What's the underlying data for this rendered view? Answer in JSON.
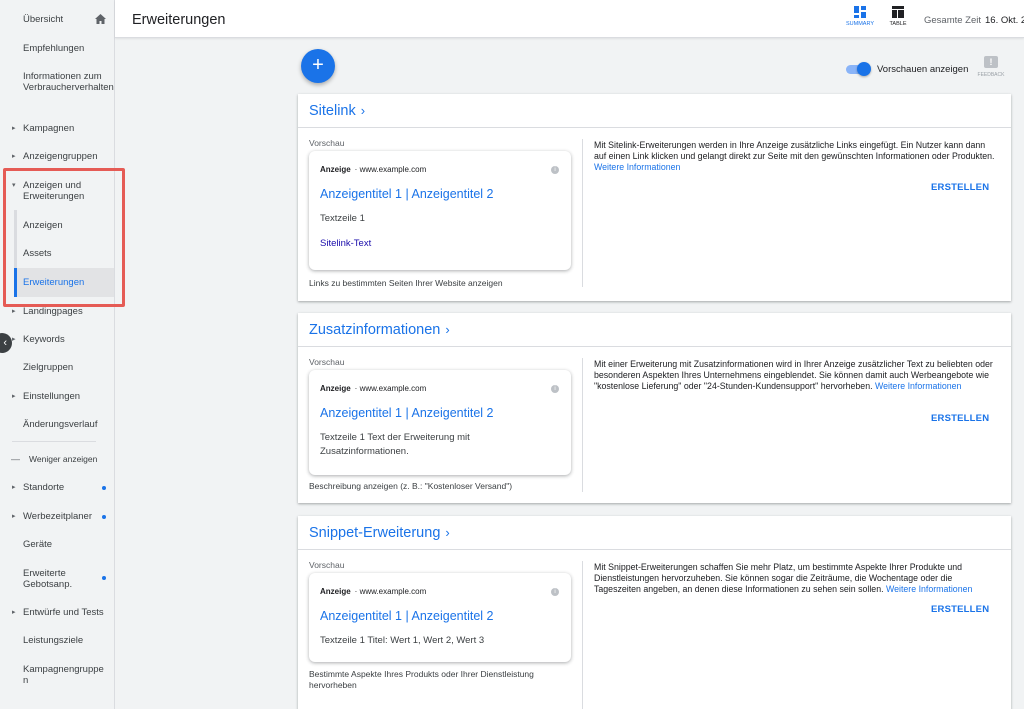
{
  "header": {
    "title": "Erweiterungen",
    "view_summary": "SUMMARY",
    "view_table": "TABLE",
    "range_label": "Gesamte Zeit",
    "range_date": "16. Okt. 2"
  },
  "sidebar": {
    "items": [
      {
        "id": "uebersicht",
        "label": "Übersicht"
      },
      {
        "id": "empfehlungen",
        "label": "Empfehlungen"
      },
      {
        "id": "verbraucher",
        "label": "Informationen zum Verbraucherverhalten"
      },
      {
        "id": "kampagnen",
        "label": "Kampagnen"
      },
      {
        "id": "anzeigengruppen",
        "label": "Anzeigengruppen"
      },
      {
        "id": "anzeigen-erweiterungen",
        "label": "Anzeigen und Erweiterungen"
      },
      {
        "id": "anzeigen",
        "label": "Anzeigen"
      },
      {
        "id": "assets",
        "label": "Assets"
      },
      {
        "id": "erweiterungen",
        "label": "Erweiterungen"
      },
      {
        "id": "landingpages",
        "label": "Landingpages"
      },
      {
        "id": "keywords",
        "label": "Keywords"
      },
      {
        "id": "zielgruppen",
        "label": "Zielgruppen"
      },
      {
        "id": "einstellungen",
        "label": "Einstellungen"
      },
      {
        "id": "aenderungsverlauf",
        "label": "Änderungsverlauf"
      },
      {
        "id": "weniger",
        "label": "Weniger anzeigen"
      },
      {
        "id": "standorte",
        "label": "Standorte"
      },
      {
        "id": "werbezeitplaner",
        "label": "Werbezeitplaner"
      },
      {
        "id": "geraete",
        "label": "Geräte"
      },
      {
        "id": "gebotsanp",
        "label": "Erweiterte Gebotsanp."
      },
      {
        "id": "entwuerfe",
        "label": "Entwürfe und Tests"
      },
      {
        "id": "leistungsziele",
        "label": "Leistungsziele"
      },
      {
        "id": "kampagnengruppen",
        "label": "Kampagnengruppen"
      }
    ],
    "collapse_glyph": "‹"
  },
  "toolbar": {
    "add_glyph": "+",
    "preview_toggle_label": "Vorschauen anzeigen",
    "feedback_label": "FEEDBACK"
  },
  "cards": [
    {
      "title": "Sitelink",
      "preview_label": "Vorschau",
      "ad_label": "Anzeige",
      "ad_url": "www.example.com",
      "ad_headline": "Anzeigentitel 1 | Anzeigentitel 2",
      "ad_text": "Textzeile 1",
      "ad_link": "Sitelink-Text",
      "caption": "Links zu bestimmten Seiten Ihrer Website anzeigen",
      "description": "Mit Sitelink-Erweiterungen werden in Ihre Anzeige zusätzliche Links eingefügt. Ein Nutzer kann dann auf einen Link klicken und gelangt direkt zur Seite mit den gewünschten Informationen oder Produkten.",
      "more_link": "Weitere Informationen",
      "create_label": "ERSTELLEN"
    },
    {
      "title": "Zusatzinformationen",
      "preview_label": "Vorschau",
      "ad_label": "Anzeige",
      "ad_url": "www.example.com",
      "ad_headline": "Anzeigentitel 1 | Anzeigentitel 2",
      "ad_text": "Textzeile 1 Text der Erweiterung mit Zusatzinformationen.",
      "caption": "Beschreibung anzeigen (z. B.: \"Kostenloser Versand\")",
      "description": "Mit einer Erweiterung mit Zusatzinformationen wird in Ihrer Anzeige zusätzlicher Text zu beliebten oder besonderen Aspekten Ihres Unternehmens eingeblendet. Sie können damit auch Werbeangebote wie \"kostenlose Lieferung\" oder \"24-Stunden-Kundensupport\" hervorheben.",
      "more_link": "Weitere Informationen",
      "create_label": "ERSTELLEN"
    },
    {
      "title": "Snippet-Erweiterung",
      "preview_label": "Vorschau",
      "ad_label": "Anzeige",
      "ad_url": "www.example.com",
      "ad_headline": "Anzeigentitel 1 | Anzeigentitel 2",
      "ad_text": "Textzeile 1 Titel: Wert 1, Wert 2, Wert 3",
      "caption": "Bestimmte Aspekte Ihres Produkts oder Ihrer Dienstleistung hervorheben",
      "description": "Mit Snippet-Erweiterungen schaffen Sie mehr Platz, um bestimmte Aspekte Ihrer Produkte und Dienstleistungen hervorzuheben. Sie können sogar die Zeiträume, die Wochentage oder die Tageszeiten angeben, an denen diese Informationen zu sehen sein sollen.",
      "more_link": "Weitere Informationen",
      "create_label": "ERSTELLEN"
    }
  ],
  "colors": {
    "accent": "#1a73e8",
    "highlight": "#e55b55"
  }
}
